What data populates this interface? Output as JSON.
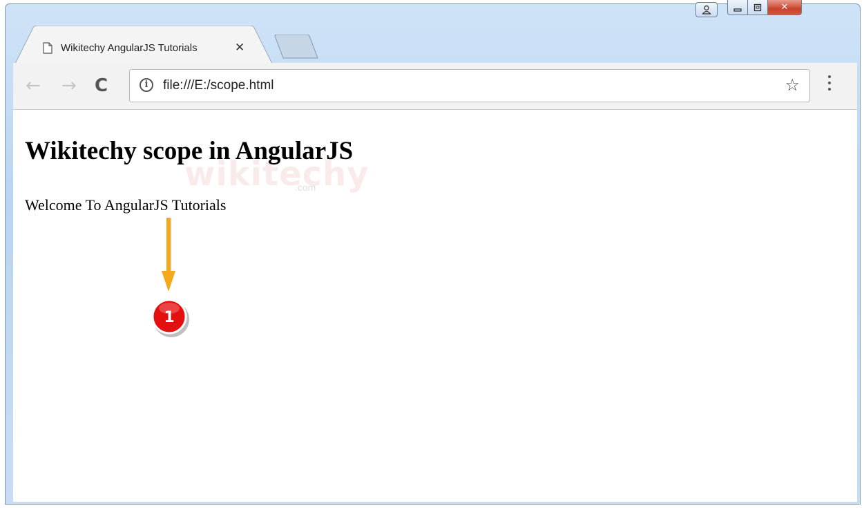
{
  "window": {
    "controls": {
      "minimize": "▁",
      "maximize": "▢",
      "close": "✕",
      "user": "👤"
    }
  },
  "tab": {
    "title": "Wikitechy AngularJS Tutorials",
    "close": "✕",
    "icon": "page-icon"
  },
  "toolbar": {
    "back": "←",
    "forward": "→",
    "reload": "C",
    "info_symbol": "i",
    "url": "file:///E:/scope.html",
    "star": "☆"
  },
  "page": {
    "heading": "Wikitechy scope in AngularJS",
    "paragraph": "Welcome To AngularJS Tutorials",
    "watermark": "wikitechy",
    "watermark_sub": ".com"
  },
  "annotation": {
    "marker_number": "1",
    "arrow_color": "#f5a81a",
    "marker_color": "#e41010"
  }
}
